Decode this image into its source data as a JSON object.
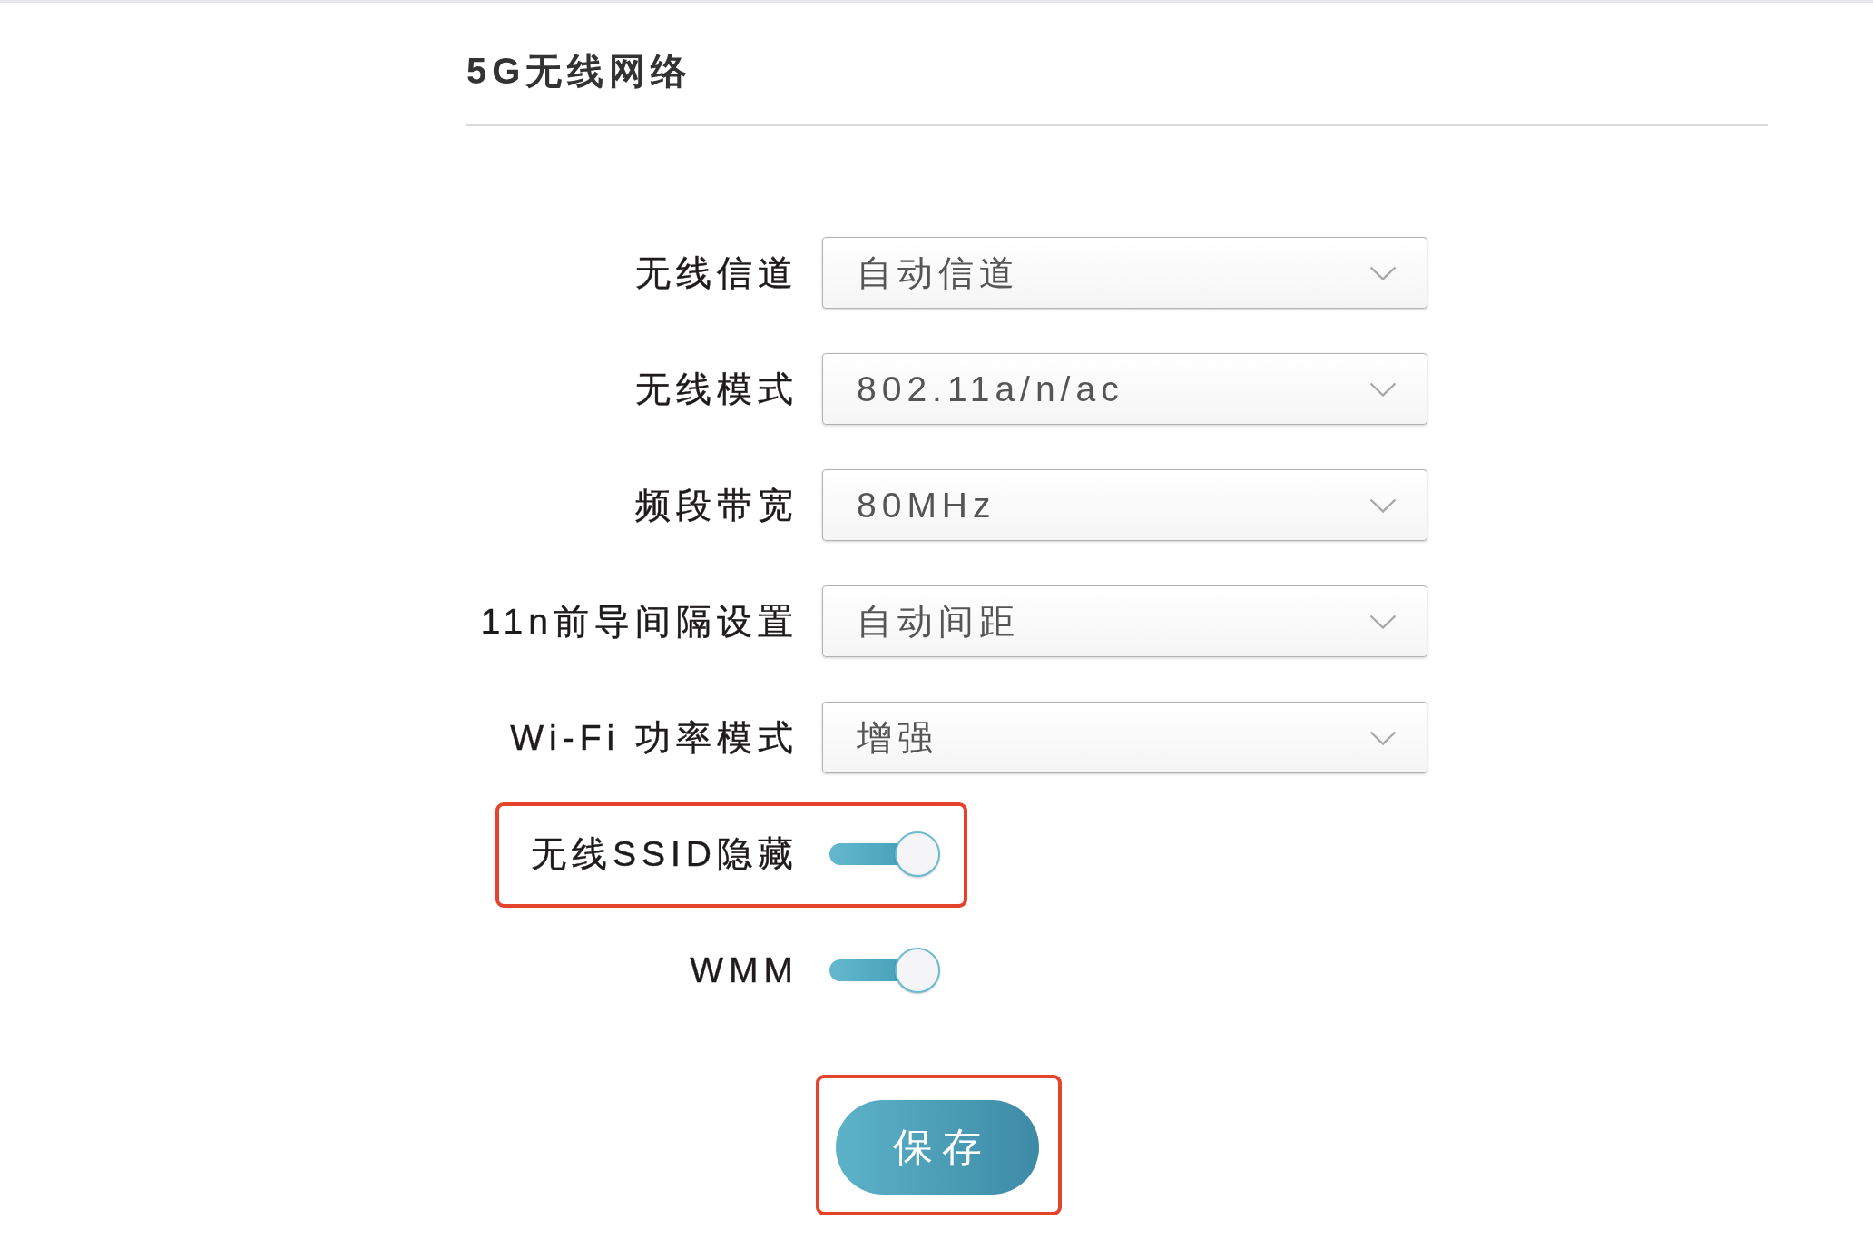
{
  "section": {
    "title": "5G无线网络"
  },
  "settings": [
    {
      "kind": "select",
      "label": "无线信道",
      "value": "自动信道",
      "highlighted": false
    },
    {
      "kind": "select",
      "label": "无线模式",
      "value": "802.11a/n/ac",
      "highlighted": false
    },
    {
      "kind": "select",
      "label": "频段带宽",
      "value": "80MHz",
      "highlighted": false
    },
    {
      "kind": "select",
      "label": "11n前导间隔设置",
      "value": "自动间距",
      "highlighted": false
    },
    {
      "kind": "select",
      "label": "Wi-Fi 功率模式",
      "value": "增强",
      "highlighted": false
    },
    {
      "kind": "switch",
      "label": "无线SSID隐藏",
      "on": true,
      "highlighted": true
    },
    {
      "kind": "switch",
      "label": "WMM",
      "on": true,
      "highlighted": false
    }
  ],
  "save_button": {
    "label": "保存",
    "highlighted": true
  }
}
